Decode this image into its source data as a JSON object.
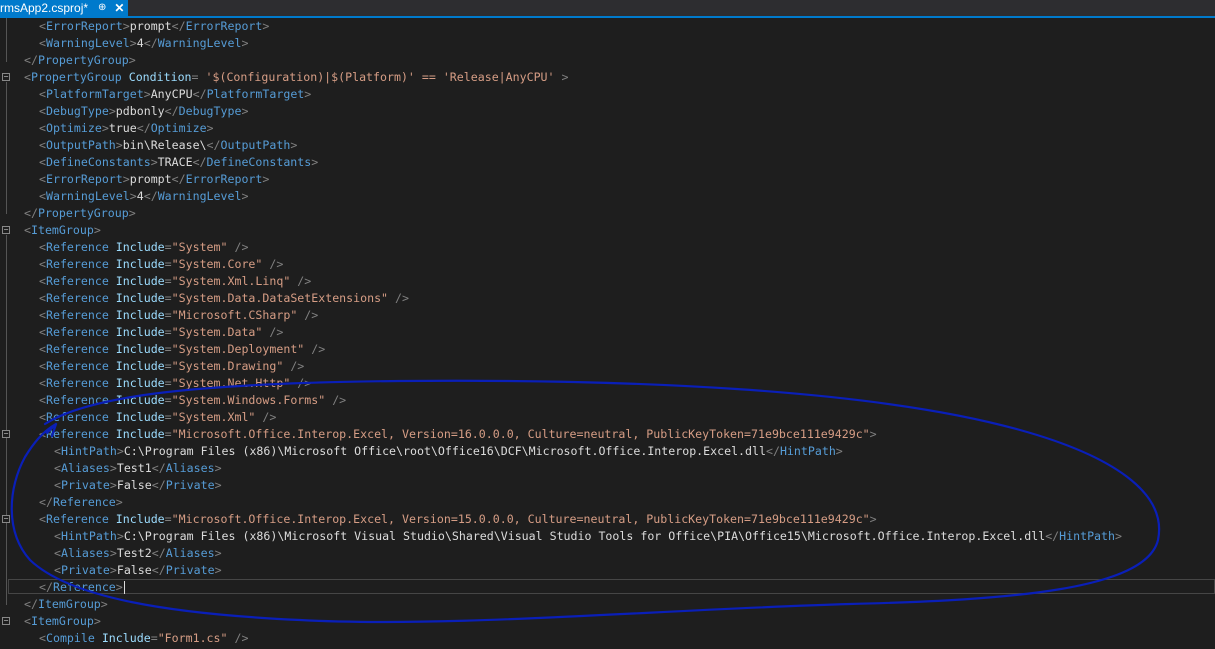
{
  "tab": {
    "title": "rmsApp2.csproj*",
    "pin_glyph": "⊕",
    "close_glyph": "✕"
  },
  "editor": {
    "lines": [
      {
        "indent": 2,
        "segments": [
          [
            "p",
            "<"
          ],
          [
            "t",
            "ErrorReport"
          ],
          [
            "p",
            ">"
          ],
          [
            "x",
            "prompt"
          ],
          [
            "p",
            "</"
          ],
          [
            "t",
            "ErrorReport"
          ],
          [
            "p",
            ">"
          ]
        ]
      },
      {
        "indent": 2,
        "segments": [
          [
            "p",
            "<"
          ],
          [
            "t",
            "WarningLevel"
          ],
          [
            "p",
            ">"
          ],
          [
            "x",
            "4"
          ],
          [
            "p",
            "</"
          ],
          [
            "t",
            "WarningLevel"
          ],
          [
            "p",
            ">"
          ]
        ]
      },
      {
        "indent": 1,
        "segments": [
          [
            "p",
            "</"
          ],
          [
            "t",
            "PropertyGroup"
          ],
          [
            "p",
            ">"
          ]
        ]
      },
      {
        "indent": 1,
        "segments": [
          [
            "p",
            "<"
          ],
          [
            "t",
            "PropertyGroup "
          ],
          [
            "a",
            "Condition"
          ],
          [
            "p",
            "="
          ],
          [
            "v",
            " '$(Configuration)|$(Platform)' == 'Release|AnyCPU' "
          ],
          [
            "p",
            ">"
          ]
        ]
      },
      {
        "indent": 2,
        "segments": [
          [
            "p",
            "<"
          ],
          [
            "t",
            "PlatformTarget"
          ],
          [
            "p",
            ">"
          ],
          [
            "x",
            "AnyCPU"
          ],
          [
            "p",
            "</"
          ],
          [
            "t",
            "PlatformTarget"
          ],
          [
            "p",
            ">"
          ]
        ]
      },
      {
        "indent": 2,
        "segments": [
          [
            "p",
            "<"
          ],
          [
            "t",
            "DebugType"
          ],
          [
            "p",
            ">"
          ],
          [
            "x",
            "pdbonly"
          ],
          [
            "p",
            "</"
          ],
          [
            "t",
            "DebugType"
          ],
          [
            "p",
            ">"
          ]
        ]
      },
      {
        "indent": 2,
        "segments": [
          [
            "p",
            "<"
          ],
          [
            "t",
            "Optimize"
          ],
          [
            "p",
            ">"
          ],
          [
            "x",
            "true"
          ],
          [
            "p",
            "</"
          ],
          [
            "t",
            "Optimize"
          ],
          [
            "p",
            ">"
          ]
        ]
      },
      {
        "indent": 2,
        "segments": [
          [
            "p",
            "<"
          ],
          [
            "t",
            "OutputPath"
          ],
          [
            "p",
            ">"
          ],
          [
            "x",
            "bin\\Release\\"
          ],
          [
            "p",
            "</"
          ],
          [
            "t",
            "OutputPath"
          ],
          [
            "p",
            ">"
          ]
        ]
      },
      {
        "indent": 2,
        "segments": [
          [
            "p",
            "<"
          ],
          [
            "t",
            "DefineConstants"
          ],
          [
            "p",
            ">"
          ],
          [
            "x",
            "TRACE"
          ],
          [
            "p",
            "</"
          ],
          [
            "t",
            "DefineConstants"
          ],
          [
            "p",
            ">"
          ]
        ]
      },
      {
        "indent": 2,
        "segments": [
          [
            "p",
            "<"
          ],
          [
            "t",
            "ErrorReport"
          ],
          [
            "p",
            ">"
          ],
          [
            "x",
            "prompt"
          ],
          [
            "p",
            "</"
          ],
          [
            "t",
            "ErrorReport"
          ],
          [
            "p",
            ">"
          ]
        ]
      },
      {
        "indent": 2,
        "segments": [
          [
            "p",
            "<"
          ],
          [
            "t",
            "WarningLevel"
          ],
          [
            "p",
            ">"
          ],
          [
            "x",
            "4"
          ],
          [
            "p",
            "</"
          ],
          [
            "t",
            "WarningLevel"
          ],
          [
            "p",
            ">"
          ]
        ]
      },
      {
        "indent": 1,
        "segments": [
          [
            "p",
            "</"
          ],
          [
            "t",
            "PropertyGroup"
          ],
          [
            "p",
            ">"
          ]
        ]
      },
      {
        "indent": 1,
        "segments": [
          [
            "p",
            "<"
          ],
          [
            "t",
            "ItemGroup"
          ],
          [
            "p",
            ">"
          ]
        ]
      },
      {
        "indent": 2,
        "segments": [
          [
            "p",
            "<"
          ],
          [
            "t",
            "Reference "
          ],
          [
            "a",
            "Include"
          ],
          [
            "p",
            "="
          ],
          [
            "v",
            "\"System\""
          ],
          [
            "p",
            " />"
          ]
        ]
      },
      {
        "indent": 2,
        "segments": [
          [
            "p",
            "<"
          ],
          [
            "t",
            "Reference "
          ],
          [
            "a",
            "Include"
          ],
          [
            "p",
            "="
          ],
          [
            "v",
            "\"System.Core\""
          ],
          [
            "p",
            " />"
          ]
        ]
      },
      {
        "indent": 2,
        "segments": [
          [
            "p",
            "<"
          ],
          [
            "t",
            "Reference "
          ],
          [
            "a",
            "Include"
          ],
          [
            "p",
            "="
          ],
          [
            "v",
            "\"System.Xml.Linq\""
          ],
          [
            "p",
            " />"
          ]
        ]
      },
      {
        "indent": 2,
        "segments": [
          [
            "p",
            "<"
          ],
          [
            "t",
            "Reference "
          ],
          [
            "a",
            "Include"
          ],
          [
            "p",
            "="
          ],
          [
            "v",
            "\"System.Data.DataSetExtensions\""
          ],
          [
            "p",
            " />"
          ]
        ]
      },
      {
        "indent": 2,
        "segments": [
          [
            "p",
            "<"
          ],
          [
            "t",
            "Reference "
          ],
          [
            "a",
            "Include"
          ],
          [
            "p",
            "="
          ],
          [
            "v",
            "\"Microsoft.CSharp\""
          ],
          [
            "p",
            " />"
          ]
        ]
      },
      {
        "indent": 2,
        "segments": [
          [
            "p",
            "<"
          ],
          [
            "t",
            "Reference "
          ],
          [
            "a",
            "Include"
          ],
          [
            "p",
            "="
          ],
          [
            "v",
            "\"System.Data\""
          ],
          [
            "p",
            " />"
          ]
        ]
      },
      {
        "indent": 2,
        "segments": [
          [
            "p",
            "<"
          ],
          [
            "t",
            "Reference "
          ],
          [
            "a",
            "Include"
          ],
          [
            "p",
            "="
          ],
          [
            "v",
            "\"System.Deployment\""
          ],
          [
            "p",
            " />"
          ]
        ]
      },
      {
        "indent": 2,
        "segments": [
          [
            "p",
            "<"
          ],
          [
            "t",
            "Reference "
          ],
          [
            "a",
            "Include"
          ],
          [
            "p",
            "="
          ],
          [
            "v",
            "\"System.Drawing\""
          ],
          [
            "p",
            " />"
          ]
        ]
      },
      {
        "indent": 2,
        "segments": [
          [
            "p",
            "<"
          ],
          [
            "t",
            "Reference "
          ],
          [
            "a",
            "Include"
          ],
          [
            "p",
            "="
          ],
          [
            "v",
            "\"System.Net.Http\""
          ],
          [
            "p",
            " />"
          ]
        ]
      },
      {
        "indent": 2,
        "segments": [
          [
            "p",
            "<"
          ],
          [
            "t",
            "Reference "
          ],
          [
            "a",
            "Include"
          ],
          [
            "p",
            "="
          ],
          [
            "v",
            "\"System.Windows.Forms\""
          ],
          [
            "p",
            " />"
          ]
        ]
      },
      {
        "indent": 2,
        "segments": [
          [
            "p",
            "<"
          ],
          [
            "t",
            "Reference "
          ],
          [
            "a",
            "Include"
          ],
          [
            "p",
            "="
          ],
          [
            "v",
            "\"System.Xml\""
          ],
          [
            "p",
            " />"
          ]
        ]
      },
      {
        "indent": 2,
        "segments": [
          [
            "p",
            "<"
          ],
          [
            "t",
            "Reference "
          ],
          [
            "a",
            "Include"
          ],
          [
            "p",
            "="
          ],
          [
            "v",
            "\"Microsoft.Office.Interop.Excel, Version=16.0.0.0, Culture=neutral, PublicKeyToken=71e9bce111e9429c\""
          ],
          [
            "p",
            ">"
          ]
        ]
      },
      {
        "indent": 3,
        "segments": [
          [
            "p",
            "<"
          ],
          [
            "t",
            "HintPath"
          ],
          [
            "p",
            ">"
          ],
          [
            "x",
            "C:\\Program Files (x86)\\Microsoft Office\\root\\Office16\\DCF\\Microsoft.Office.Interop.Excel.dll"
          ],
          [
            "p",
            "</"
          ],
          [
            "t",
            "HintPath"
          ],
          [
            "p",
            ">"
          ]
        ]
      },
      {
        "indent": 3,
        "segments": [
          [
            "p",
            "<"
          ],
          [
            "t",
            "Aliases"
          ],
          [
            "p",
            ">"
          ],
          [
            "x",
            "Test1"
          ],
          [
            "p",
            "</"
          ],
          [
            "t",
            "Aliases"
          ],
          [
            "p",
            ">"
          ]
        ]
      },
      {
        "indent": 3,
        "segments": [
          [
            "p",
            "<"
          ],
          [
            "t",
            "Private"
          ],
          [
            "p",
            ">"
          ],
          [
            "x",
            "False"
          ],
          [
            "p",
            "</"
          ],
          [
            "t",
            "Private"
          ],
          [
            "p",
            ">"
          ]
        ]
      },
      {
        "indent": 2,
        "segments": [
          [
            "p",
            "</"
          ],
          [
            "t",
            "Reference"
          ],
          [
            "p",
            ">"
          ]
        ]
      },
      {
        "indent": 2,
        "segments": [
          [
            "p",
            "<"
          ],
          [
            "t",
            "Reference "
          ],
          [
            "a",
            "Include"
          ],
          [
            "p",
            "="
          ],
          [
            "v",
            "\"Microsoft.Office.Interop.Excel, Version=15.0.0.0, Culture=neutral, PublicKeyToken=71e9bce111e9429c\""
          ],
          [
            "p",
            ">"
          ]
        ]
      },
      {
        "indent": 3,
        "segments": [
          [
            "p",
            "<"
          ],
          [
            "t",
            "HintPath"
          ],
          [
            "p",
            ">"
          ],
          [
            "x",
            "C:\\Program Files (x86)\\Microsoft Visual Studio\\Shared\\Visual Studio Tools for Office\\PIA\\Office15\\Microsoft.Office.Interop.Excel.dll"
          ],
          [
            "p",
            "</"
          ],
          [
            "t",
            "HintPath"
          ],
          [
            "p",
            ">"
          ]
        ]
      },
      {
        "indent": 3,
        "segments": [
          [
            "p",
            "<"
          ],
          [
            "t",
            "Aliases"
          ],
          [
            "p",
            ">"
          ],
          [
            "x",
            "Test2"
          ],
          [
            "p",
            "</"
          ],
          [
            "t",
            "Aliases"
          ],
          [
            "p",
            ">"
          ]
        ]
      },
      {
        "indent": 3,
        "segments": [
          [
            "p",
            "<"
          ],
          [
            "t",
            "Private"
          ],
          [
            "p",
            ">"
          ],
          [
            "x",
            "False"
          ],
          [
            "p",
            "</"
          ],
          [
            "t",
            "Private"
          ],
          [
            "p",
            ">"
          ]
        ]
      },
      {
        "indent": 2,
        "segments": [
          [
            "p",
            "</"
          ],
          [
            "t",
            "Reference"
          ],
          [
            "p",
            ">"
          ]
        ]
      },
      {
        "indent": 1,
        "segments": [
          [
            "p",
            "</"
          ],
          [
            "t",
            "ItemGroup"
          ],
          [
            "p",
            ">"
          ]
        ]
      },
      {
        "indent": 1,
        "segments": [
          [
            "p",
            "<"
          ],
          [
            "t",
            "ItemGroup"
          ],
          [
            "p",
            ">"
          ]
        ]
      },
      {
        "indent": 2,
        "segments": [
          [
            "p",
            "<"
          ],
          [
            "t",
            "Compile "
          ],
          [
            "a",
            "Include"
          ],
          [
            "p",
            "="
          ],
          [
            "v",
            "\"Form1.cs\""
          ],
          [
            "p",
            " />"
          ]
        ]
      }
    ]
  },
  "colors": {
    "tag": "#569cd6",
    "punctuation": "#808080",
    "attribute": "#9cdcfe",
    "string": "#d69d85",
    "text": "#dcdcdc",
    "accent": "#007acc",
    "annotation": "#0a1fb8"
  }
}
